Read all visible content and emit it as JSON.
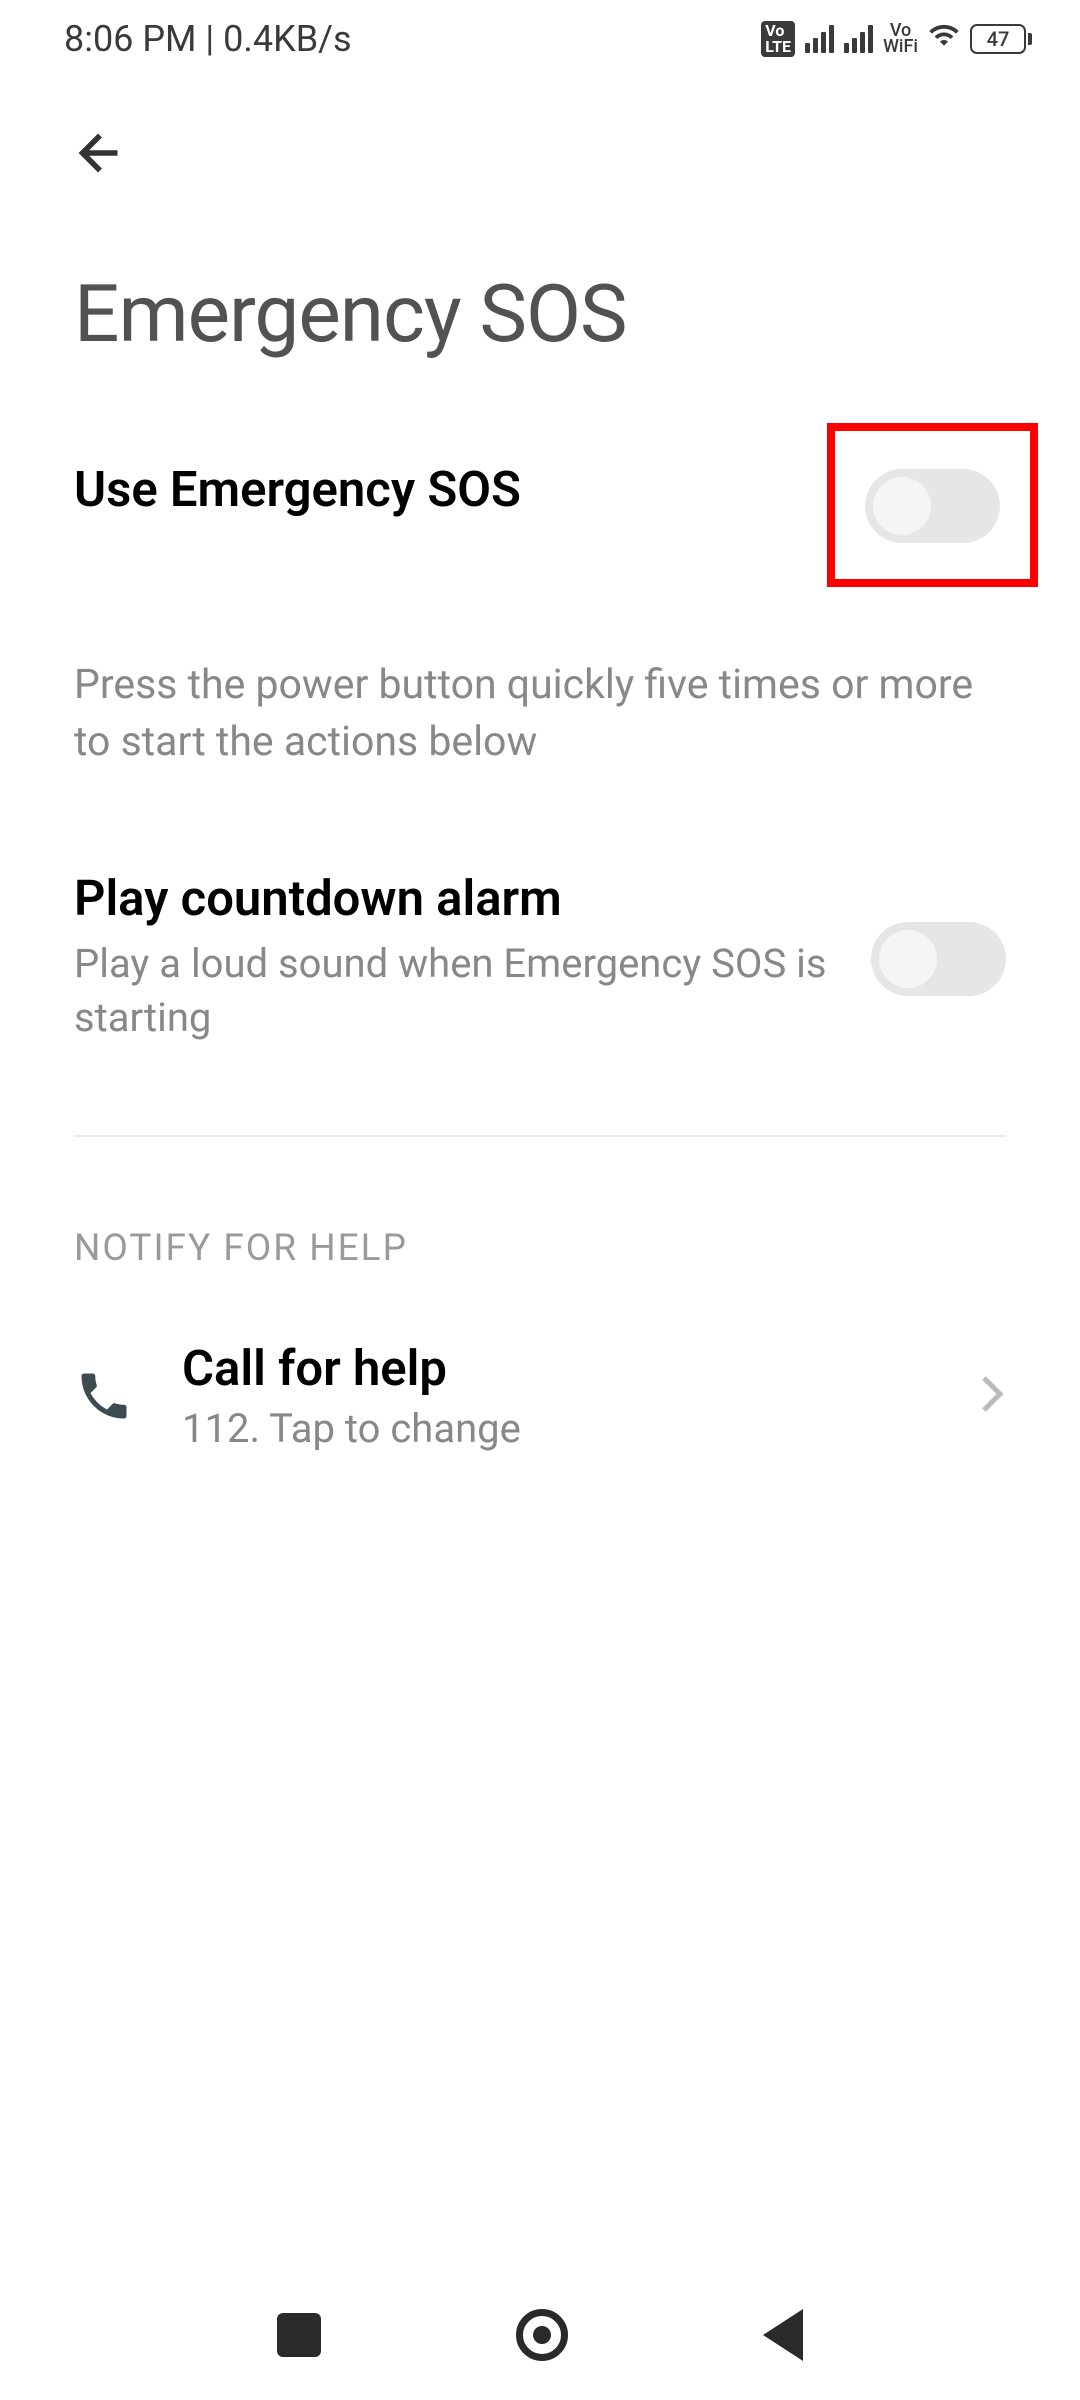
{
  "status_bar": {
    "time": "8:06 PM",
    "speed": "0.4KB/s",
    "volte": "Vo\nLTE",
    "vowifi_top": "Vo",
    "vowifi_bottom": "WiFi",
    "battery": "47"
  },
  "page": {
    "title": "Emergency SOS"
  },
  "settings": {
    "use_sos": {
      "title": "Use Emergency SOS",
      "description": "Press the power button quickly five times or more to start the actions below"
    },
    "countdown": {
      "title": "Play countdown alarm",
      "subtitle": "Play a loud sound when Emergency SOS is starting"
    }
  },
  "notify_section": {
    "header": "NOTIFY FOR HELP",
    "call": {
      "title": "Call for help",
      "subtitle": "112. Tap to change"
    }
  }
}
